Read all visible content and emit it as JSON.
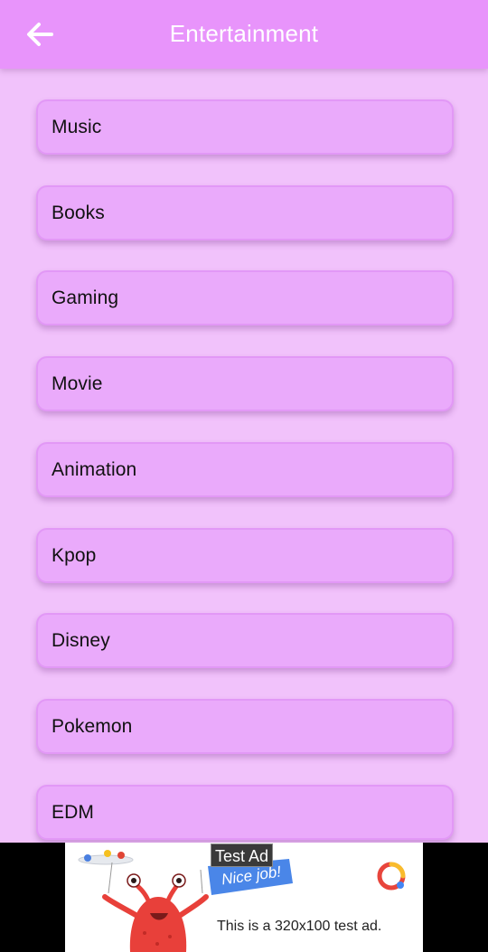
{
  "header": {
    "title": "Entertainment",
    "back_icon": "arrow-left-icon"
  },
  "categories": [
    {
      "label": "Music"
    },
    {
      "label": "Books"
    },
    {
      "label": "Gaming"
    },
    {
      "label": "Movie"
    },
    {
      "label": "Animation"
    },
    {
      "label": "Kpop"
    },
    {
      "label": "Disney"
    },
    {
      "label": "Pokemon"
    },
    {
      "label": "EDM"
    }
  ],
  "ad": {
    "tag": "Test Ad",
    "banner_text": "This is a 320x100 test ad.",
    "mascot_caption": "Nice job!"
  },
  "colors": {
    "appbar": "#e894fb",
    "background": "#f1c2fb",
    "card": "#eaaafb"
  }
}
